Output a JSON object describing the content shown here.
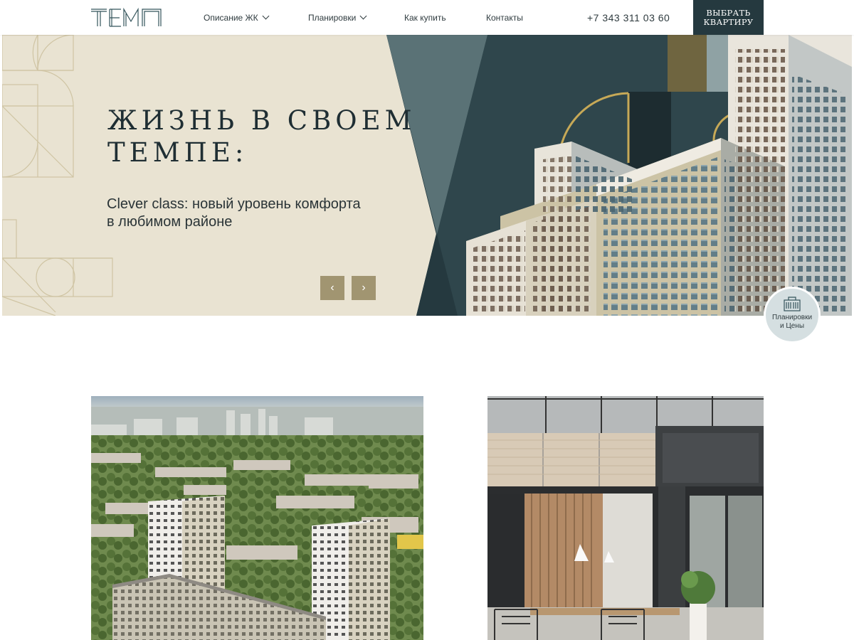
{
  "header": {
    "logo_text": "ТЕМП",
    "nav": [
      {
        "label": "Описание ЖК",
        "has_dropdown": true
      },
      {
        "label": "Планировки",
        "has_dropdown": true
      },
      {
        "label": "Как купить",
        "has_dropdown": false
      },
      {
        "label": "Контакты",
        "has_dropdown": false
      }
    ],
    "phone": "+7 343 311 03 60",
    "cta_line1": "ВЫБРАТЬ",
    "cta_line2": "КВАРТИРУ"
  },
  "hero": {
    "title_line1": "ЖИЗНЬ В СВОЕМ",
    "title_line2": "ТЕМПЕ:",
    "subtitle_line1": "Clever class: новый уровень комфорта",
    "subtitle_line2": "в любимом районе",
    "prev_icon": "‹",
    "next_icon": "›"
  },
  "badge": {
    "line1": "Планировки",
    "line2": "и Цены",
    "icon": "building-icon"
  },
  "colors": {
    "cream": "#e9e3d2",
    "dark_teal": "#25393f",
    "gold": "#a19571",
    "sage": "#5a7276"
  }
}
